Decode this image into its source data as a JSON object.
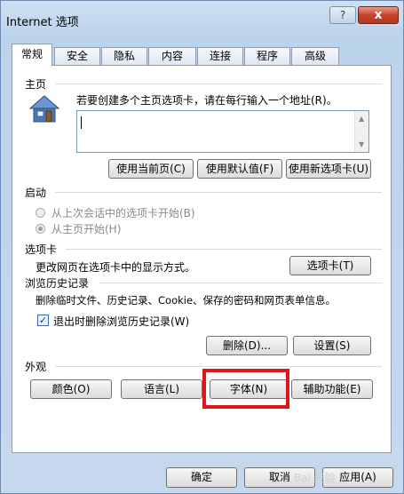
{
  "window": {
    "title": "Internet 选项",
    "help_label": "?",
    "close_label": "x"
  },
  "tabs": [
    "常规",
    "安全",
    "隐私",
    "内容",
    "连接",
    "程序",
    "高级"
  ],
  "home": {
    "section": "主页",
    "instruction": "若要创建多个主页选项卡，请在每行输入一个地址(R)。",
    "buttons": [
      "使用当前页(C)",
      "使用默认值(F)",
      "使用新选项卡(U)"
    ]
  },
  "startup": {
    "section": "启动",
    "option1": "从上次会话中的选项卡开始(B)",
    "option2": "从主页开始(H)"
  },
  "tabs_section": {
    "section": "选项卡",
    "description": "更改网页在选项卡中的显示方式。",
    "button": "选项卡(T)"
  },
  "history": {
    "section": "浏览历史记录",
    "description": "删除临时文件、历史记录、Cookie、保存的密码和网页表单信息。",
    "checkbox": "退出时删除浏览历史记录(W)",
    "delete_button": "删除(D)...",
    "settings_button": "设置(S)"
  },
  "appearance": {
    "section": "外观",
    "buttons": [
      "颜色(O)",
      "语言(L)",
      "字体(N)",
      "辅助功能(E)"
    ]
  },
  "footer": {
    "ok": "确定",
    "cancel": "取消",
    "apply": "应用(A)"
  },
  "watermark": "Bai 经验"
}
